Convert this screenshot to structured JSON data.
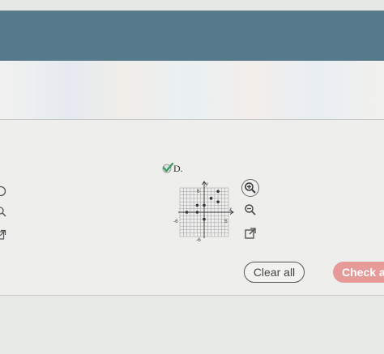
{
  "option": {
    "label": "D."
  },
  "graph": {
    "x_axis_label": "x",
    "y_axis_label": "y",
    "tick_top": "6",
    "tick_bottom": "-6",
    "tick_left": "-6",
    "tick_right": "6",
    "points": [
      {
        "x": -5,
        "y": 0
      },
      {
        "x": -2,
        "y": 0
      },
      {
        "x": -2,
        "y": 2
      },
      {
        "x": 0,
        "y": 2
      },
      {
        "x": 0,
        "y": -2
      },
      {
        "x": 2,
        "y": 4
      },
      {
        "x": 4,
        "y": 3
      },
      {
        "x": 4,
        "y": 6
      }
    ]
  },
  "buttons": {
    "clear_all": "Clear all",
    "check_answer": "Check ar"
  },
  "colors": {
    "header": "#557a8c",
    "check_button": "#e69b98",
    "check_mark": "#3f9a63"
  }
}
